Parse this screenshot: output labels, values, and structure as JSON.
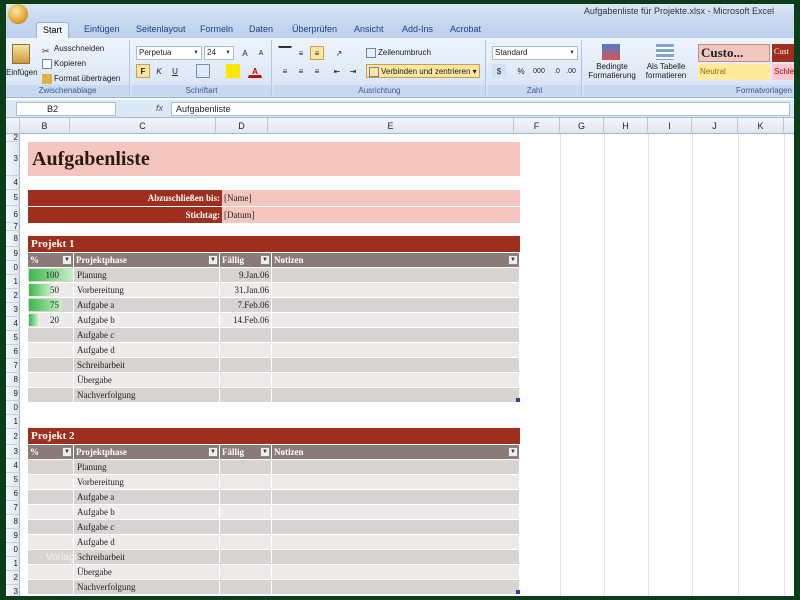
{
  "window": {
    "title": "Aufgabenliste für Projekte.xlsx - Microsoft Excel"
  },
  "tabs": [
    "Start",
    "Einfügen",
    "Seitenlayout",
    "Formeln",
    "Daten",
    "Überprüfen",
    "Ansicht",
    "Add-Ins",
    "Acrobat"
  ],
  "ribbon": {
    "clipboard": {
      "paste": "Einfügen",
      "cut": "Ausschneiden",
      "copy": "Kopieren",
      "format_painter": "Format übertragen",
      "label": "Zwischenablage"
    },
    "font": {
      "name": "Perpetua",
      "size": "24",
      "bold": "F",
      "italic": "K",
      "underline": "U",
      "label": "Schriftart"
    },
    "alignment": {
      "wrap": "Zeilenumbruch",
      "merge": "Verbinden und zentrieren",
      "label": "Ausrichtung"
    },
    "number": {
      "format": "Standard",
      "percent": "%",
      "thousands": "000",
      "label": "Zahl"
    },
    "styles": {
      "conditional": "Bedingte Formatierung",
      "as_table": "Als Tabelle formatieren",
      "custom": "Custo...",
      "neutral": "Neutral",
      "bad": "Schle",
      "custom2": "Cust",
      "label": "Formatvorlagen"
    }
  },
  "formula_bar": {
    "cell_ref": "B2",
    "fx": "fx",
    "content": "Aufgabenliste"
  },
  "columns": [
    "B",
    "C",
    "D",
    "E",
    "F",
    "G",
    "H",
    "I",
    "J",
    "K"
  ],
  "rows": [
    "2",
    "3",
    "4",
    "5",
    "6",
    "7",
    "8",
    "9",
    "0",
    "1",
    "2",
    "3",
    "4",
    "5",
    "6",
    "7",
    "8",
    "9",
    "0",
    "1",
    "2",
    "3",
    "4",
    "5",
    "6",
    "7",
    "8",
    "9",
    "0",
    "1",
    "2",
    "3"
  ],
  "sheet": {
    "title": "Aufgabenliste",
    "due_label": "Abzuschließen bis:",
    "due_value": "[Name]",
    "deadline_label": "Stichtag:",
    "deadline_value": "[Datum]",
    "table_headers": {
      "percent": "%",
      "phase": "Projektphase",
      "due": "Fällig",
      "notes": "Notizen"
    },
    "projects": [
      {
        "name": "Projekt 1",
        "rows": [
          {
            "percent": "100",
            "progress": 1.0,
            "phase": "Planung",
            "due": "9.Jan.06"
          },
          {
            "percent": "50",
            "progress": 0.5,
            "phase": "Vorbereitung",
            "due": "31.Jan.06"
          },
          {
            "percent": "75",
            "progress": 0.75,
            "phase": "Aufgabe a",
            "due": "7.Feb.06"
          },
          {
            "percent": "20",
            "progress": 0.2,
            "phase": "Aufgabe b",
            "due": "14.Feb.06"
          },
          {
            "percent": "",
            "progress": 0,
            "phase": "Aufgabe c",
            "due": ""
          },
          {
            "percent": "",
            "progress": 0,
            "phase": "Aufgabe d",
            "due": ""
          },
          {
            "percent": "",
            "progress": 0,
            "phase": "Schreibarbeit",
            "due": ""
          },
          {
            "percent": "",
            "progress": 0,
            "phase": "Übergabe",
            "due": ""
          },
          {
            "percent": "",
            "progress": 0,
            "phase": "Nachverfolgung",
            "due": ""
          }
        ]
      },
      {
        "name": "Projekt 2",
        "rows": [
          {
            "percent": "",
            "progress": 0,
            "phase": "Planung",
            "due": ""
          },
          {
            "percent": "",
            "progress": 0,
            "phase": "Vorbereitung",
            "due": ""
          },
          {
            "percent": "",
            "progress": 0,
            "phase": "Aufgabe a",
            "due": ""
          },
          {
            "percent": "",
            "progress": 0,
            "phase": "Aufgabe b",
            "due": ""
          },
          {
            "percent": "",
            "progress": 0,
            "phase": "Aufgabe c",
            "due": ""
          },
          {
            "percent": "",
            "progress": 0,
            "phase": "Aufgabe d",
            "due": ""
          },
          {
            "percent": "",
            "progress": 0,
            "phase": "Schreibarbeit",
            "due": ""
          },
          {
            "percent": "",
            "progress": 0,
            "phase": "Übergabe",
            "due": ""
          },
          {
            "percent": "",
            "progress": 0,
            "phase": "Nachverfolgung",
            "due": ""
          }
        ]
      }
    ]
  },
  "watermark": "Vorlage"
}
